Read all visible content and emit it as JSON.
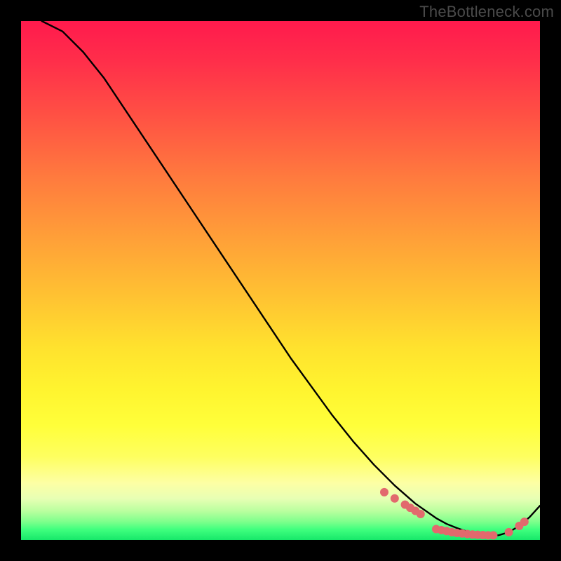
{
  "watermark": "TheBottleneck.com",
  "chart_data": {
    "type": "line",
    "title": "",
    "xlabel": "",
    "ylabel": "",
    "xlim": [
      0,
      100
    ],
    "ylim": [
      0,
      100
    ],
    "series": [
      {
        "name": "bottleneck-curve",
        "x": [
          4,
          8,
          12,
          16,
          20,
          24,
          28,
          32,
          36,
          40,
          44,
          48,
          52,
          56,
          60,
          64,
          68,
          72,
          76,
          80,
          82,
          84,
          86,
          88,
          90,
          92,
          94,
          96,
          98,
          100
        ],
        "y": [
          100,
          98,
          94,
          89,
          83,
          77,
          71,
          65,
          59,
          53,
          47,
          41,
          35,
          29.5,
          24,
          19,
          14.5,
          10.5,
          7,
          4.2,
          3.1,
          2.3,
          1.6,
          1.1,
          0.8,
          0.9,
          1.5,
          2.7,
          4.4,
          6.6
        ]
      }
    ],
    "markers": {
      "name": "highlight-dots",
      "color": "#e2696d",
      "radius": 6,
      "points": [
        {
          "x": 70,
          "y": 9.2
        },
        {
          "x": 72,
          "y": 8.0
        },
        {
          "x": 74,
          "y": 6.8
        },
        {
          "x": 75,
          "y": 6.2
        },
        {
          "x": 76,
          "y": 5.6
        },
        {
          "x": 77,
          "y": 5.0
        },
        {
          "x": 80,
          "y": 2.1
        },
        {
          "x": 81,
          "y": 1.9
        },
        {
          "x": 82,
          "y": 1.7
        },
        {
          "x": 83,
          "y": 1.5
        },
        {
          "x": 84,
          "y": 1.35
        },
        {
          "x": 85,
          "y": 1.25
        },
        {
          "x": 86,
          "y": 1.15
        },
        {
          "x": 87,
          "y": 1.05
        },
        {
          "x": 88,
          "y": 1.0
        },
        {
          "x": 89,
          "y": 0.95
        },
        {
          "x": 90,
          "y": 0.9
        },
        {
          "x": 91,
          "y": 0.9
        },
        {
          "x": 94,
          "y": 1.5
        },
        {
          "x": 96,
          "y": 2.7
        },
        {
          "x": 97,
          "y": 3.5
        }
      ]
    }
  }
}
